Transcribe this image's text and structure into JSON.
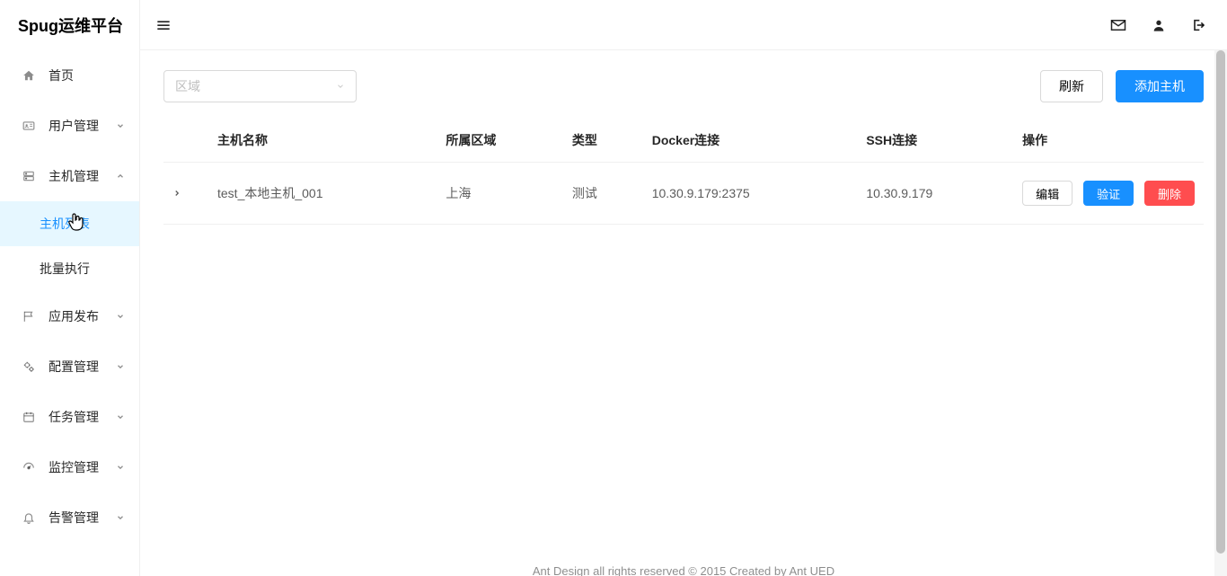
{
  "app_title": "Spug运维平台",
  "header_icons": {
    "menu": "bars",
    "mail": "envelope",
    "user": "user",
    "logout": "sign-out"
  },
  "sidebar": {
    "items": [
      {
        "icon": "home",
        "label": "首页",
        "expand": null
      },
      {
        "icon": "id-card",
        "label": "用户管理",
        "expand": "down"
      },
      {
        "icon": "server",
        "label": "主机管理",
        "expand": "up",
        "children": [
          {
            "label": "主机列表",
            "selected": true
          },
          {
            "label": "批量执行",
            "selected": false
          }
        ]
      },
      {
        "icon": "flag",
        "label": "应用发布",
        "expand": "down"
      },
      {
        "icon": "cogs",
        "label": "配置管理",
        "expand": "down"
      },
      {
        "icon": "calendar",
        "label": "任务管理",
        "expand": "down"
      },
      {
        "icon": "dashboard",
        "label": "监控管理",
        "expand": "down"
      },
      {
        "icon": "bell",
        "label": "告警管理",
        "expand": "down"
      }
    ]
  },
  "toolbar": {
    "region_placeholder": "区域",
    "refresh_label": "刷新",
    "add_host_label": "添加主机"
  },
  "table": {
    "columns": {
      "host_name": "主机名称",
      "region": "所属区域",
      "type": "类型",
      "docker": "Docker连接",
      "ssh": "SSH连接",
      "actions": "操作"
    },
    "row_buttons": {
      "edit": "编辑",
      "verify": "验证",
      "delete": "删除"
    },
    "rows": [
      {
        "host_name": "test_本地主机_001",
        "region": "上海",
        "type": "测试",
        "docker": "10.30.9.179:2375",
        "ssh": "10.30.9.179"
      }
    ]
  },
  "footer_text": "Ant Design all rights reserved © 2015 Created by Ant UED"
}
